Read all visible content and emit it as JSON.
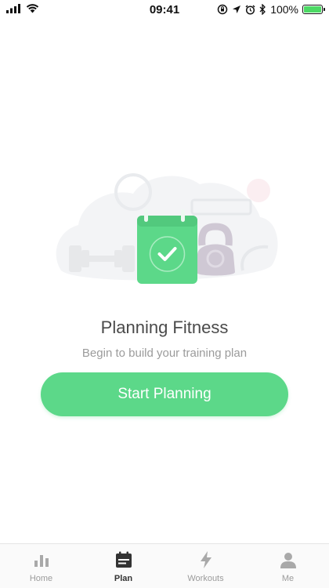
{
  "status_bar": {
    "time": "09:41",
    "battery": "100%",
    "battery_level": 1.0,
    "icons": [
      "signal-icon",
      "wifi-icon",
      "rotation-lock-icon",
      "location-icon",
      "alarm-icon",
      "bluetooth-icon",
      "battery-icon"
    ]
  },
  "main": {
    "title": "Planning Fitness",
    "subtitle": "Begin to build your training plan",
    "start_button_label": "Start Planning",
    "illustration_icons": [
      "calendar-check-icon",
      "dumbbell-icon",
      "kettlebell-icon"
    ]
  },
  "colors": {
    "accent": "#5cd889",
    "title": "#4a4a4a",
    "subtitle": "#9b9b9b",
    "tab_inactive": "#9b9b9b",
    "tab_active": "#333333"
  },
  "tab_bar": {
    "tabs": [
      {
        "label": "Home",
        "icon": "bar-chart-icon",
        "active": false
      },
      {
        "label": "Plan",
        "icon": "calendar-icon",
        "active": true
      },
      {
        "label": "Workouts",
        "icon": "lightning-icon",
        "active": false
      },
      {
        "label": "Me",
        "icon": "person-icon",
        "active": false
      }
    ]
  }
}
